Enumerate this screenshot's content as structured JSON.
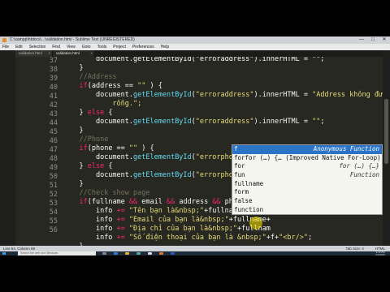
{
  "window": {
    "title": "C:\\xampp\\htdocs\\...\\validation.html - Sublime Text (UNREGISTERED)",
    "controls": [
      "—",
      "□",
      "✕"
    ]
  },
  "menu": [
    "File",
    "Edit",
    "Selection",
    "Find",
    "View",
    "Goto",
    "Tools",
    "Project",
    "Preferences",
    "Help"
  ],
  "tabs": [
    {
      "label": "validation.html",
      "active": false
    },
    {
      "label": "validation.html",
      "active": true
    }
  ],
  "editor": {
    "line_numbers": [
      "37",
      "38",
      "39",
      "40",
      "41",
      "42",
      "43",
      "44",
      "45",
      "46",
      "47",
      "48",
      "49",
      "50",
      "51",
      "52",
      "53",
      "54",
      "55",
      "56"
    ],
    "lines": [
      {
        "indent": "        ",
        "segments": [
          {
            "text": "document.getElementById(\"erroraddress\").innerHTML = \"\";",
            "cls": ""
          }
        ]
      },
      {
        "indent": "    ",
        "segments": [
          {
            "text": "}",
            "cls": ""
          }
        ]
      },
      {
        "indent": "    ",
        "segments": [
          {
            "text": "//Address",
            "cls": "cm"
          }
        ]
      },
      {
        "indent": "    ",
        "segments": [
          {
            "text": "if",
            "cls": "kw"
          },
          {
            "text": "(address == ",
            "cls": ""
          },
          {
            "text": "\"\"",
            "cls": "st"
          },
          {
            "text": " ) {",
            "cls": ""
          }
        ]
      },
      {
        "indent": "        ",
        "segments": [
          {
            "text": "document.",
            "cls": ""
          },
          {
            "text": "getElementById",
            "cls": "fn"
          },
          {
            "text": "(",
            "cls": ""
          },
          {
            "text": "\"erroraddress\"",
            "cls": "st"
          },
          {
            "text": ").innerHTML = ",
            "cls": ""
          },
          {
            "text": "\"Address không được",
            "cls": "st"
          }
        ]
      },
      {
        "indent": "            ",
        "segments": [
          {
            "text": "rỗng.\";",
            "cls": "st"
          }
        ]
      },
      {
        "indent": "    ",
        "segments": [
          {
            "text": "} ",
            "cls": ""
          },
          {
            "text": "else",
            "cls": "kw"
          },
          {
            "text": " {",
            "cls": ""
          }
        ]
      },
      {
        "indent": "        ",
        "segments": [
          {
            "text": "document.",
            "cls": ""
          },
          {
            "text": "getElementById",
            "cls": "fn"
          },
          {
            "text": "(",
            "cls": ""
          },
          {
            "text": "\"erroraddress\"",
            "cls": "st"
          },
          {
            "text": ").innerHTML = ",
            "cls": ""
          },
          {
            "text": "\"\"",
            "cls": "st"
          },
          {
            "text": ";",
            "cls": ""
          }
        ]
      },
      {
        "indent": "    ",
        "segments": [
          {
            "text": "}",
            "cls": ""
          }
        ]
      },
      {
        "indent": "    ",
        "segments": [
          {
            "text": "//Phone",
            "cls": "cm"
          }
        ]
      },
      {
        "indent": "    ",
        "segments": [
          {
            "text": "if",
            "cls": "kw"
          },
          {
            "text": "(phone == ",
            "cls": ""
          },
          {
            "text": "\"\"",
            "cls": "st"
          },
          {
            "text": " ) {",
            "cls": ""
          }
        ]
      },
      {
        "indent": "        ",
        "segments": [
          {
            "text": "document.",
            "cls": ""
          },
          {
            "text": "getElementById",
            "cls": "fn"
          },
          {
            "text": "(",
            "cls": ""
          },
          {
            "text": "\"errorphone\"",
            "cls": "st"
          },
          {
            "text": ").inn",
            "cls": ""
          }
        ]
      },
      {
        "indent": "    ",
        "segments": [
          {
            "text": "} ",
            "cls": ""
          },
          {
            "text": "else",
            "cls": "kw"
          },
          {
            "text": " {",
            "cls": ""
          }
        ]
      },
      {
        "indent": "        ",
        "segments": [
          {
            "text": "document.",
            "cls": ""
          },
          {
            "text": "getElementById",
            "cls": "fn"
          },
          {
            "text": "(",
            "cls": ""
          },
          {
            "text": "\"errorphone\"",
            "cls": "st"
          },
          {
            "text": ").inn",
            "cls": ""
          }
        ]
      },
      {
        "indent": "    ",
        "segments": [
          {
            "text": "}",
            "cls": ""
          }
        ]
      },
      {
        "indent": "    ",
        "segments": [
          {
            "text": "//Check show page",
            "cls": "cm"
          }
        ]
      },
      {
        "indent": "    ",
        "segments": [
          {
            "text": "if",
            "cls": "kw"
          },
          {
            "text": "(fullname ",
            "cls": ""
          },
          {
            "text": "&&",
            "cls": "kw"
          },
          {
            "text": " email ",
            "cls": ""
          },
          {
            "text": "&&",
            "cls": "kw"
          },
          {
            "text": " address ",
            "cls": ""
          },
          {
            "text": "&&",
            "cls": "kw"
          },
          {
            "text": " phone) {",
            "cls": ""
          }
        ]
      },
      {
        "indent": "        ",
        "segments": [
          {
            "text": "info ",
            "cls": ""
          },
          {
            "text": "+=",
            "cls": "kw"
          },
          {
            "text": " ",
            "cls": ""
          },
          {
            "text": "\"Tên bạn là&nbsp;\"",
            "cls": "st"
          },
          {
            "text": "+fullname+",
            "cls": ""
          },
          {
            "text": "\"<br/>\"",
            "cls": "st"
          },
          {
            "text": ";",
            "cls": ""
          }
        ]
      },
      {
        "indent": "        ",
        "segments": [
          {
            "text": "info ",
            "cls": ""
          },
          {
            "text": "+=",
            "cls": "kw"
          },
          {
            "text": " ",
            "cls": ""
          },
          {
            "text": "\"Email của bạn là&nbsp;\"",
            "cls": "st"
          },
          {
            "text": "+fullname+",
            "cls": ""
          }
        ]
      },
      {
        "indent": "        ",
        "segments": [
          {
            "text": "info ",
            "cls": ""
          },
          {
            "text": "+=",
            "cls": "kw"
          },
          {
            "text": " ",
            "cls": ""
          },
          {
            "text": "\"Địa chỉ của bạn là&nbsp;\"",
            "cls": "st"
          },
          {
            "text": "+fullnam",
            "cls": ""
          }
        ]
      },
      {
        "indent": "        ",
        "segments": [
          {
            "text": "info ",
            "cls": ""
          },
          {
            "text": "+=",
            "cls": "kw"
          },
          {
            "text": " ",
            "cls": ""
          },
          {
            "text": "\"Số điện thoại của bạn là &nbsp;\"",
            "cls": "st"
          },
          {
            "text": "+f+",
            "cls": ""
          },
          {
            "text": "\"<br/>\"",
            "cls": "st"
          },
          {
            "text": ";",
            "cls": ""
          }
        ]
      },
      {
        "indent": "    ",
        "segments": [
          {
            "text": "}",
            "cls": ""
          }
        ]
      },
      {
        "indent": "",
        "segments": [
          {
            "text": "}",
            "cls": ""
          }
        ]
      }
    ]
  },
  "autocomplete": {
    "items": [
      {
        "label": "f",
        "hint": "Anonymous Function",
        "selected": true
      },
      {
        "label": "forfor (…) {… (Improved Native For-Loop)",
        "hint": "",
        "selected": false
      },
      {
        "label": "for",
        "hint": "for (…) {…}",
        "selected": false
      },
      {
        "label": "fun",
        "hint": "Function",
        "selected": false
      },
      {
        "label": "fullname",
        "hint": "",
        "selected": false
      },
      {
        "label": "form",
        "hint": "",
        "selected": false
      },
      {
        "label": "false",
        "hint": "",
        "selected": false
      },
      {
        "label": "function",
        "hint": "",
        "selected": false
      }
    ]
  },
  "statusbar": {
    "left": "Line 54, Column 69",
    "tab_size": "Tab Size: 4",
    "syntax": "HTML"
  },
  "taskbar": {
    "search_placeholder": "Search the web and Windows",
    "time": "9:13 PM",
    "date": "2/2/2016"
  },
  "colors": {
    "editor_bg": "#272822",
    "comment": "#75715e",
    "keyword": "#f92672",
    "function": "#66d9ef",
    "string": "#e6db74",
    "selection": "#2a73c7"
  }
}
